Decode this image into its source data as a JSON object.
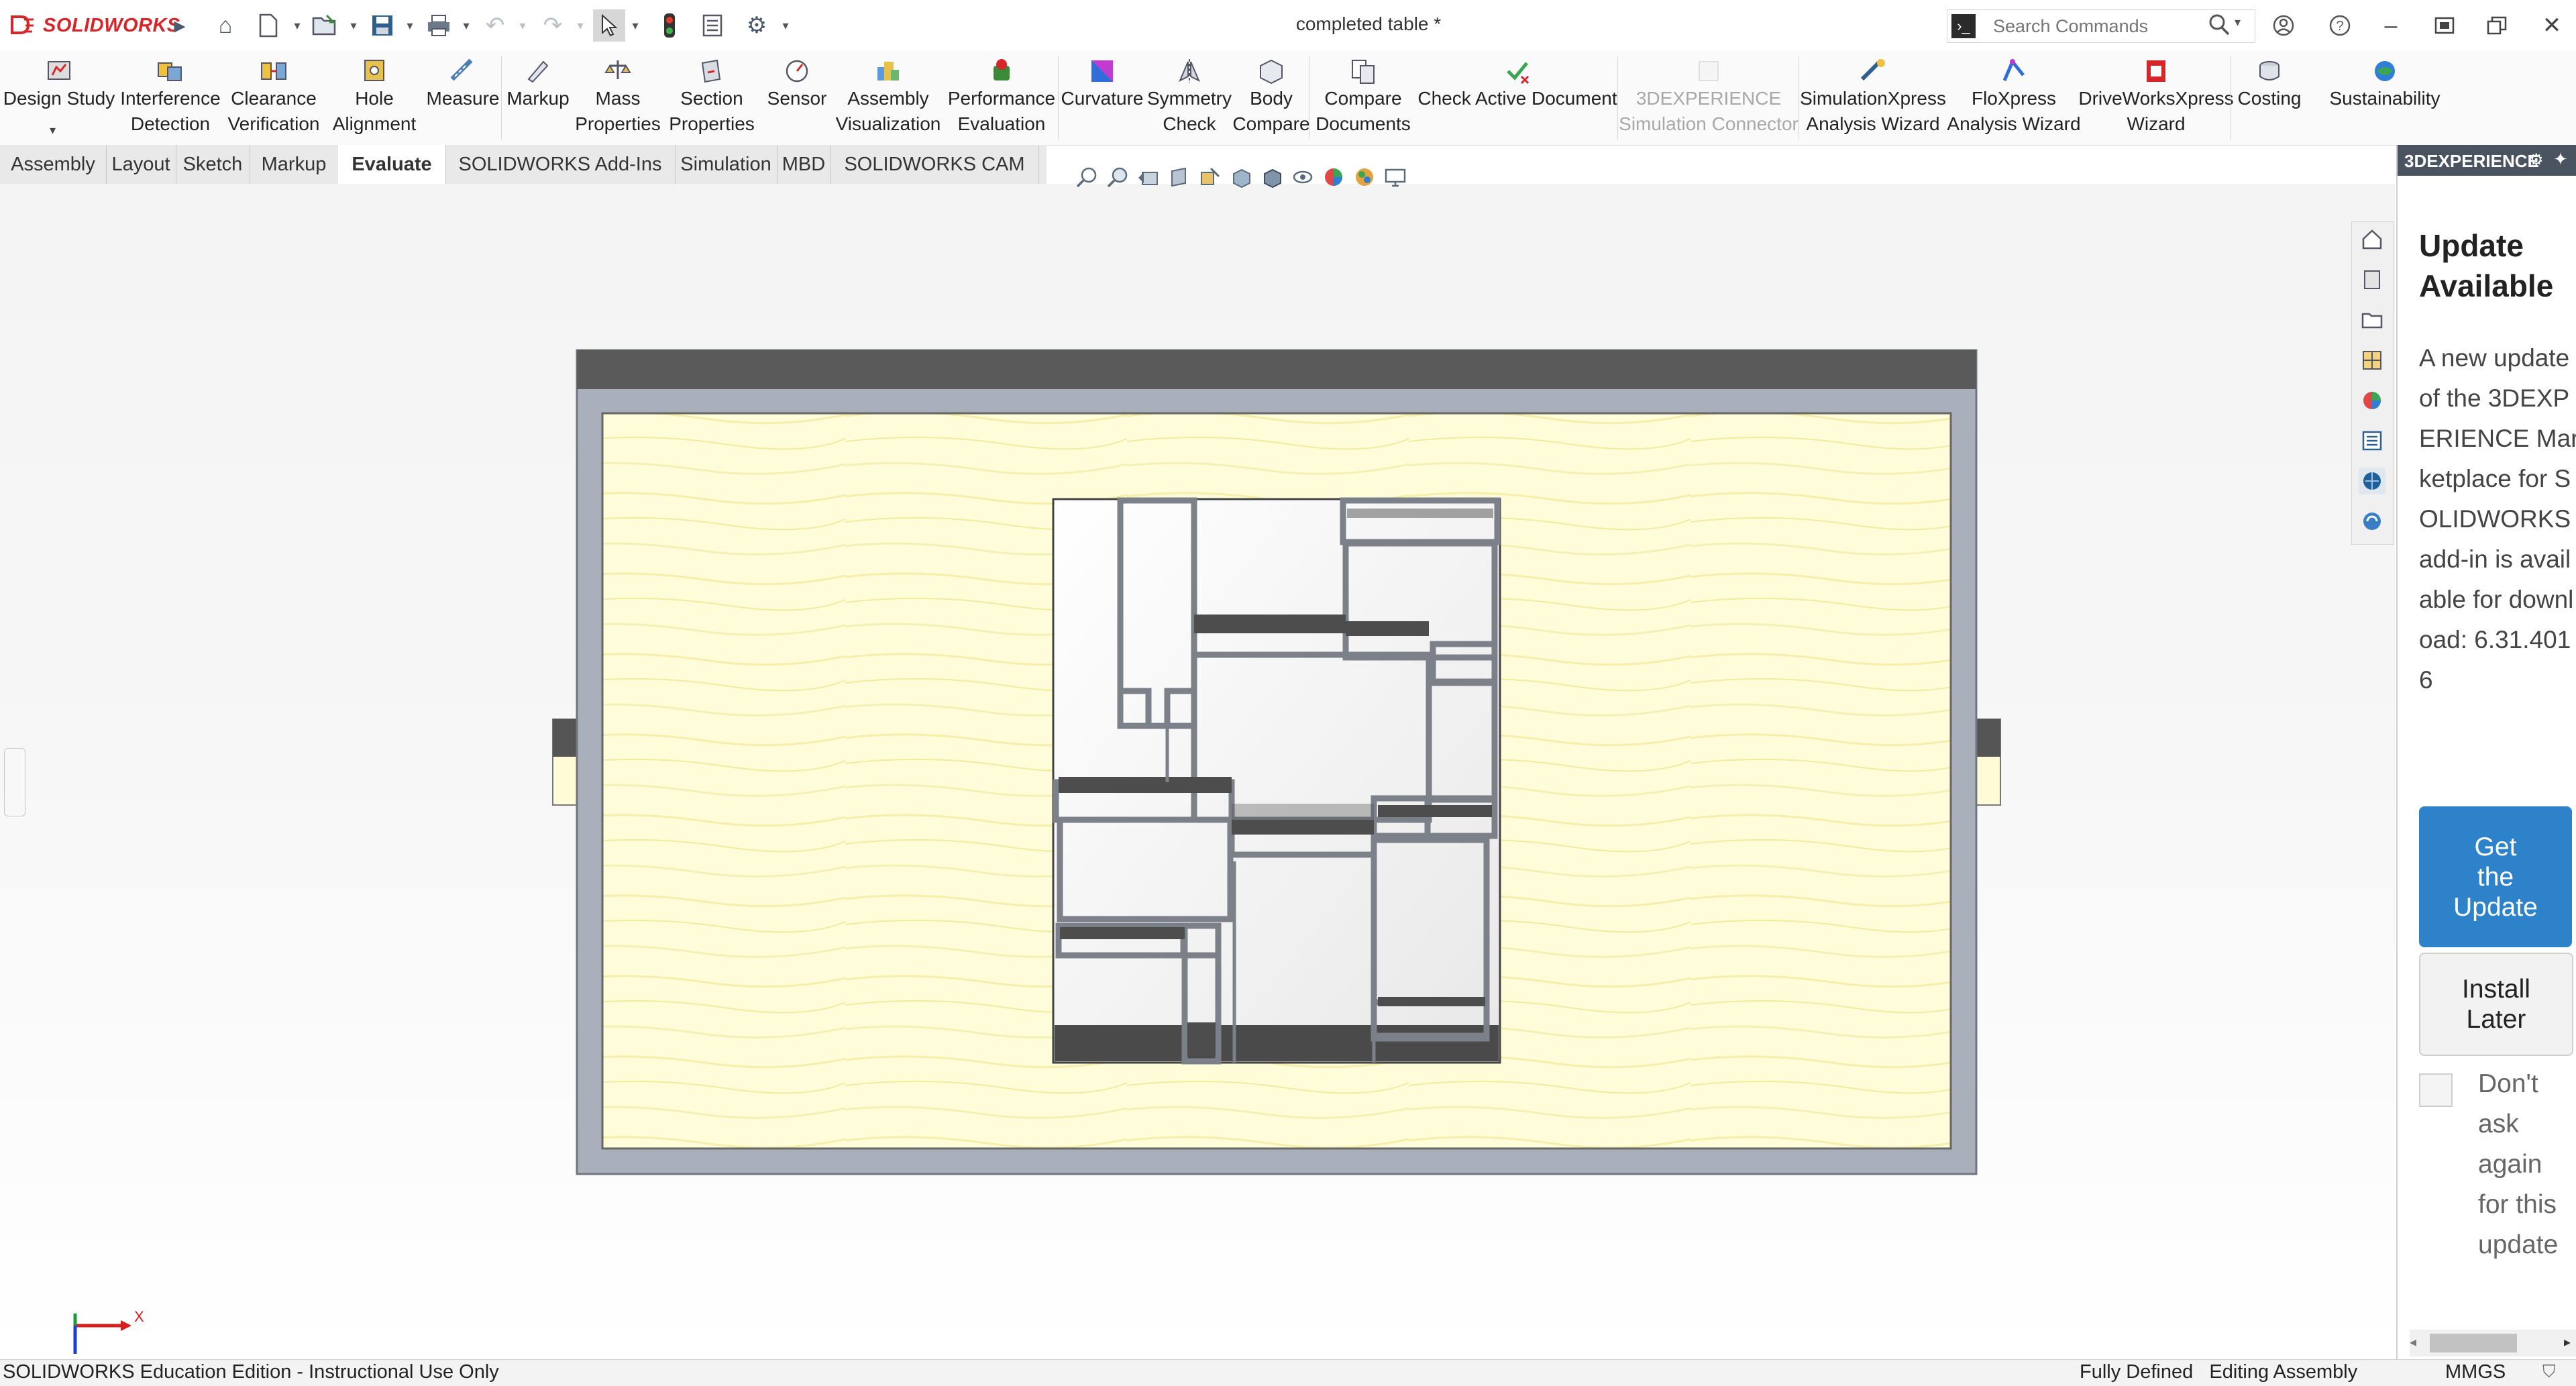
{
  "app": {
    "logo_text": "SOLIDWORKS",
    "document_title": "completed table *"
  },
  "search": {
    "placeholder": "Search Commands"
  },
  "command_manager": {
    "tools": [
      {
        "label": "Design Study",
        "icon": "design-study-icon",
        "disabled": false
      },
      {
        "label": "Interference\nDetection",
        "icon": "interference-icon",
        "disabled": false
      },
      {
        "label": "Clearance\nVerification",
        "icon": "clearance-icon",
        "disabled": false
      },
      {
        "label": "Hole\nAlignment",
        "icon": "hole-alignment-icon",
        "disabled": false
      },
      {
        "label": "Measure",
        "icon": "measure-icon",
        "disabled": false
      },
      {
        "label": "Markup",
        "icon": "markup-icon",
        "disabled": false
      },
      {
        "label": "Mass\nProperties",
        "icon": "mass-properties-icon",
        "disabled": false
      },
      {
        "label": "Section\nProperties",
        "icon": "section-properties-icon",
        "disabled": false
      },
      {
        "label": "Sensor",
        "icon": "sensor-icon",
        "disabled": false
      },
      {
        "label": "Assembly\nVisualization",
        "icon": "assembly-visualization-icon",
        "disabled": false
      },
      {
        "label": "Performance\nEvaluation",
        "icon": "performance-icon",
        "disabled": false
      },
      {
        "label": "Curvature",
        "icon": "curvature-icon",
        "disabled": false
      },
      {
        "label": "Symmetry\nCheck",
        "icon": "symmetry-icon",
        "disabled": false
      },
      {
        "label": "Body\nCompare",
        "icon": "body-compare-icon",
        "disabled": false
      },
      {
        "label": "Compare\nDocuments",
        "icon": "compare-documents-icon",
        "disabled": false
      },
      {
        "label": "Check Active Document",
        "icon": "check-document-icon",
        "disabled": false
      },
      {
        "label": "3DEXPERIENCE\nSimulation Connector",
        "icon": "simulation-connector-icon",
        "disabled": true
      },
      {
        "label": "SimulationXpress\nAnalysis Wizard",
        "icon": "simulationxpress-icon",
        "disabled": false
      },
      {
        "label": "FloXpress\nAnalysis Wizard",
        "icon": "floxpress-icon",
        "disabled": false
      },
      {
        "label": "DriveWorksXpress\nWizard",
        "icon": "driveworks-icon",
        "disabled": false
      },
      {
        "label": "Costing",
        "icon": "costing-icon",
        "disabled": false
      },
      {
        "label": "Sustainability",
        "icon": "sustainability-icon",
        "disabled": false
      }
    ]
  },
  "tabs": [
    {
      "label": "Assembly",
      "active": false
    },
    {
      "label": "Layout",
      "active": false
    },
    {
      "label": "Sketch",
      "active": false
    },
    {
      "label": "Markup",
      "active": false
    },
    {
      "label": "Evaluate",
      "active": true
    },
    {
      "label": "SOLIDWORKS Add-Ins",
      "active": false
    },
    {
      "label": "Simulation",
      "active": false
    },
    {
      "label": "MBD",
      "active": false
    },
    {
      "label": "SOLIDWORKS CAM",
      "active": false
    }
  ],
  "task_pane": {
    "header": "3DEXPERIENCE",
    "title": "Update Available",
    "body": "A new update of the 3DEXPERIENCE Marketplace for SOLIDWORKS add-in is available for download: 6.31.4016",
    "primary_button": "Get\nthe\nUpdate",
    "secondary_button": "Install\nLater",
    "checkbox_label": "Don't\nask\nagain\nfor this\nupdate",
    "checkbox_checked": false
  },
  "axes": {
    "x_label": "X"
  },
  "status": {
    "left": "SOLIDWORKS Education Edition - Instructional Use Only",
    "state": "Fully Defined   Editing Assembly",
    "units": "MMGS"
  },
  "colors": {
    "brand": "#d6262a",
    "accent": "#2e82c9",
    "tabletop": "#fffbd6",
    "frame": "#a9b0bb"
  }
}
